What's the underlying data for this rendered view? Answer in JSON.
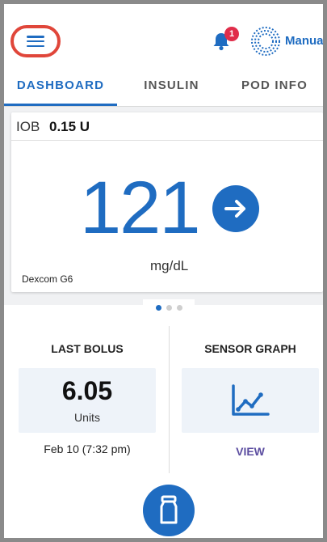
{
  "header": {
    "menu_icon": "hamburger-menu-icon",
    "notification_count": "1",
    "mode_label": "Manual"
  },
  "tabs": [
    {
      "label": "DASHBOARD",
      "active": true
    },
    {
      "label": "INSULIN",
      "active": false
    },
    {
      "label": "POD INFO",
      "active": false
    }
  ],
  "glucose": {
    "iob_label": "IOB",
    "iob_value": "0.15 U",
    "value": "121",
    "unit": "mg/dL",
    "sensor": "Dexcom G6",
    "trend_icon": "arrow-right-icon"
  },
  "pager": {
    "count": 3,
    "active_index": 0
  },
  "last_bolus": {
    "title": "LAST BOLUS",
    "value": "6.05",
    "unit": "Units",
    "date": "Feb 10 (7:32 pm)"
  },
  "sensor_graph": {
    "title": "SENSOR GRAPH",
    "icon": "line-graph-icon",
    "link": "VIEW"
  },
  "fab": {
    "icon": "bolus-vial-icon"
  },
  "colors": {
    "primary": "#1f6cc1",
    "highlight_ring": "#e0463a",
    "badge": "#e02d4a",
    "link": "#5b4da0"
  }
}
